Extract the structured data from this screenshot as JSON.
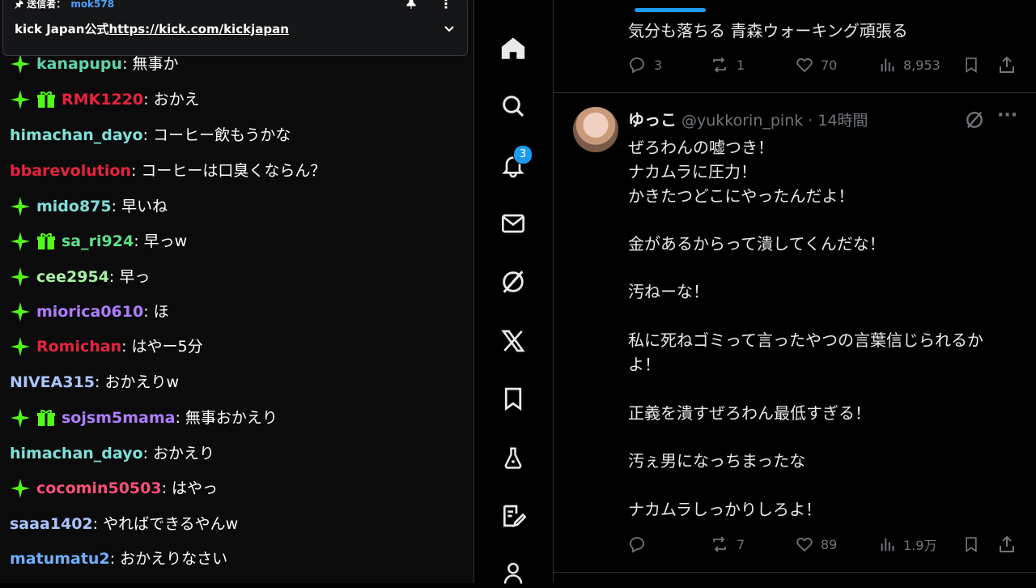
{
  "chat": {
    "pinned": {
      "label": "送信者：",
      "sender": "mok578",
      "text": "kick Japan公式",
      "link": "https://kick.com/kickjapan"
    },
    "messages": [
      {
        "user": "kanapupu",
        "color": "#5dd6a8",
        "sub": true,
        "gift": false,
        "text": "無事か"
      },
      {
        "user": "RMK1220",
        "color": "#e8233b",
        "sub": true,
        "gift": true,
        "text": "おかえ"
      },
      {
        "user": "himachan_dayo",
        "color": "#7fe0d9",
        "sub": false,
        "gift": false,
        "text": "コーヒー飲もうかな"
      },
      {
        "user": "bbarevolution",
        "color": "#e8233b",
        "sub": false,
        "gift": false,
        "text": "コーヒーは口臭くならん？"
      },
      {
        "user": "mido875",
        "color": "#7fe0d9",
        "sub": true,
        "gift": false,
        "text": "早いね"
      },
      {
        "user": "sa_ri924",
        "color": "#5ee08a",
        "sub": true,
        "gift": true,
        "text": "早っw"
      },
      {
        "user": "cee2954",
        "color": "#a8f0a0",
        "sub": true,
        "gift": false,
        "text": "早っ"
      },
      {
        "user": "miorica0610",
        "color": "#b07cff",
        "sub": true,
        "gift": false,
        "text": "ほ"
      },
      {
        "user": "Romichan",
        "color": "#e8233b",
        "sub": true,
        "gift": false,
        "text": "はやー5分"
      },
      {
        "user": "NIVEA315",
        "color": "#a9c4ff",
        "sub": false,
        "gift": false,
        "text": "おかえりw"
      },
      {
        "user": "sojsm5mama",
        "color": "#b07cff",
        "sub": true,
        "gift": true,
        "text": "無事おかえり"
      },
      {
        "user": "himachan_dayo",
        "color": "#7fe0d9",
        "sub": false,
        "gift": false,
        "text": "おかえり"
      },
      {
        "user": "cocomin50503",
        "color": "#ff4f7b",
        "sub": true,
        "gift": false,
        "text": "はやっ"
      },
      {
        "user": "saaa1402",
        "color": "#a9c4ff",
        "sub": false,
        "gift": false,
        "text": "やればできるやんw"
      },
      {
        "user": "matumatu2",
        "color": "#6fb0ff",
        "sub": false,
        "gift": false,
        "text": "おかえりなさい"
      }
    ]
  },
  "nav": {
    "notifications_count": "3",
    "items": [
      "home-icon",
      "search-icon",
      "bell-icon",
      "mail-icon",
      "grok-icon",
      "x-logo-icon",
      "bookmark-icon",
      "flask-icon",
      "compose-icon",
      "profile-icon"
    ]
  },
  "feed": {
    "prev_tweet": {
      "text_line": "気分も落ちる 青森ウォーキング頑張る",
      "replies": "3",
      "reposts": "1",
      "likes": "70",
      "views": "8,953"
    },
    "tweet": {
      "name": "ゆっこ",
      "handle": "@yukkorin_pink · 14時間",
      "lines": [
        "ぜろわんの嘘つき！",
        "ナカムラに圧力！",
        "かきたつどこにやったんだよ！",
        "",
        "金があるからって潰してくんだな！",
        "",
        "汚ねーな！",
        "",
        "私に死ねゴミって言ったやつの言葉信じられるか",
        "よ！",
        "",
        "正義を潰すぜろわん最低すぎる！",
        "",
        "汚ぇ男になっちまったな",
        "",
        "ナカムラしっかりしろよ！"
      ],
      "replies": "",
      "reposts": "7",
      "likes": "89",
      "views": "1.9万"
    }
  },
  "colors": {
    "accent": "#1d9bf0",
    "sub_badge": "#53fc18",
    "gift_badge": "#53fc18",
    "muted": "#71767b"
  }
}
